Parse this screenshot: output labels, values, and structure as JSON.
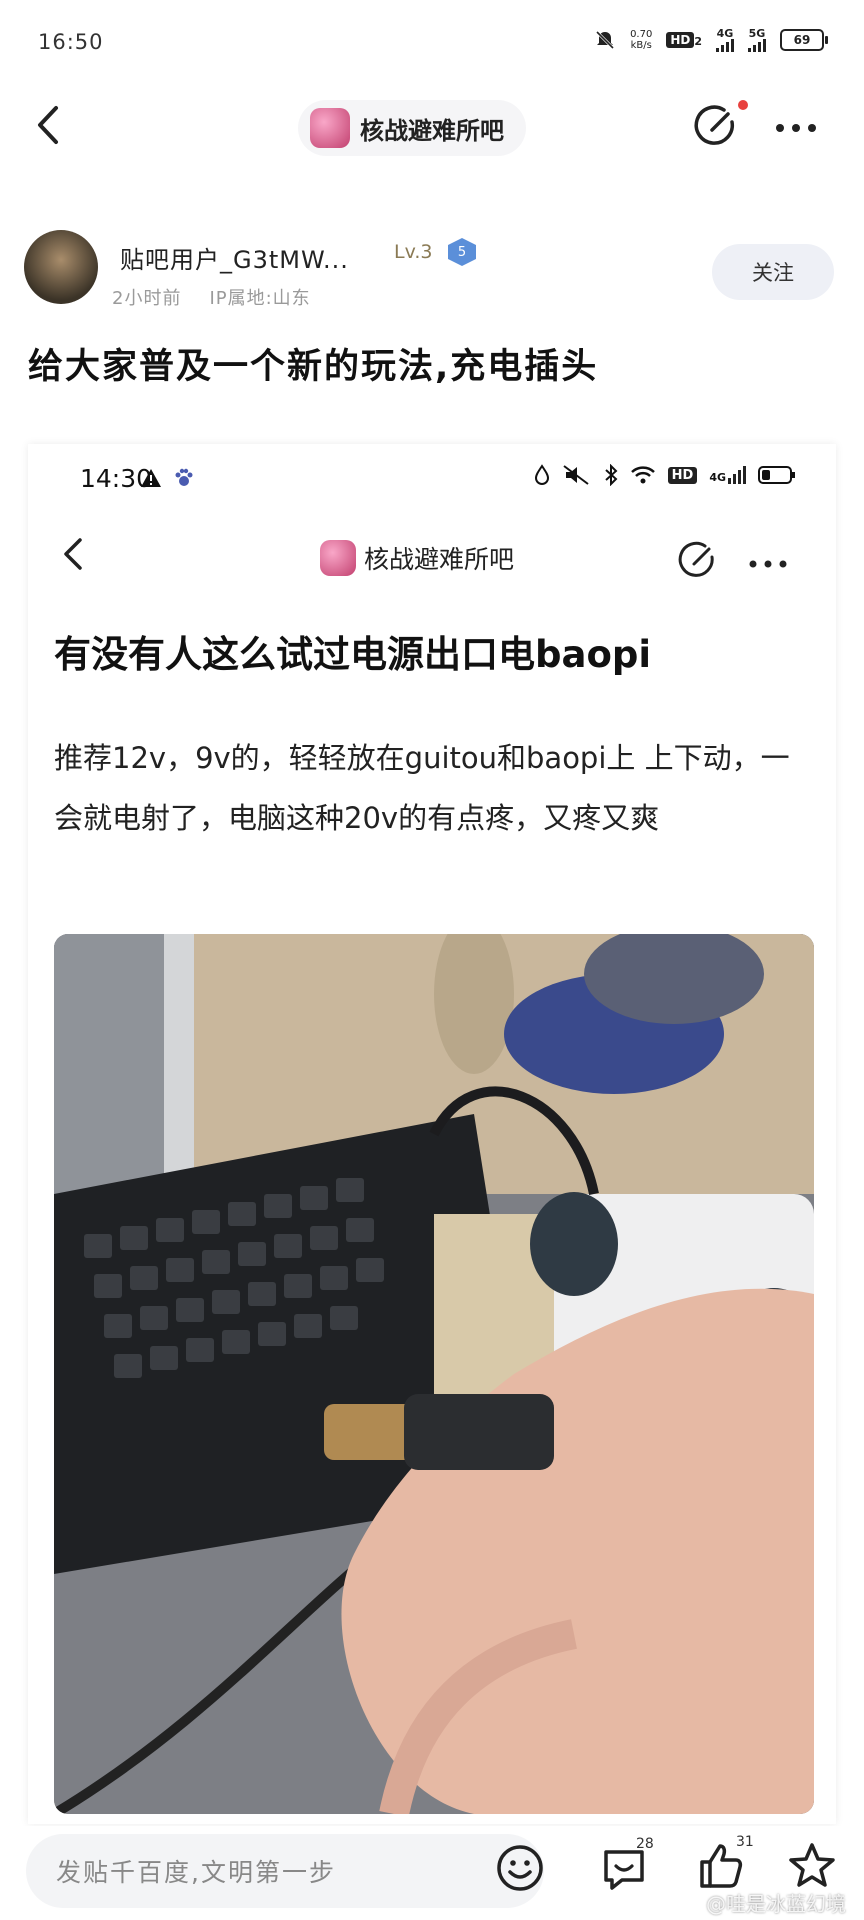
{
  "status_bar": {
    "time": "16:50",
    "net_speed_value": "0.70",
    "net_speed_unit": "kB/s",
    "hd_label": "HD",
    "hd_sub": "2",
    "sim1": "4G",
    "sim2": "5G",
    "battery": "69"
  },
  "header": {
    "forum_name": "核战避难所吧"
  },
  "author": {
    "username": "贴吧用户_G3tMW...",
    "level": "Lv.3",
    "level_badge": "5",
    "time_ago": "2小时前",
    "ip_location": "IP属地:山东",
    "follow_label": "关注"
  },
  "post": {
    "title": "给大家普及一个新的玩法,充电插头"
  },
  "embedded": {
    "status_time": "14:30",
    "hd_label": "HD",
    "network": "4G",
    "forum_name": "核战避难所吧",
    "title": "有没有人这么试过电源出口电baopi",
    "body": "推荐12v，9v的，轻轻放在guitou和baopi上 上下动，一会就电射了，电脑这种20v的有点疼，又疼又爽"
  },
  "bottom_bar": {
    "input_placeholder": "发贴千百度,文明第一步",
    "comment_count": "28",
    "like_count": "31"
  },
  "watermark": "@哇是冰蓝幻境",
  "colors": {
    "accent_red": "#e8413e",
    "pill_bg": "#f5f5f7",
    "follow_bg": "#eef0f6",
    "muted_text": "#9a9a9a"
  }
}
